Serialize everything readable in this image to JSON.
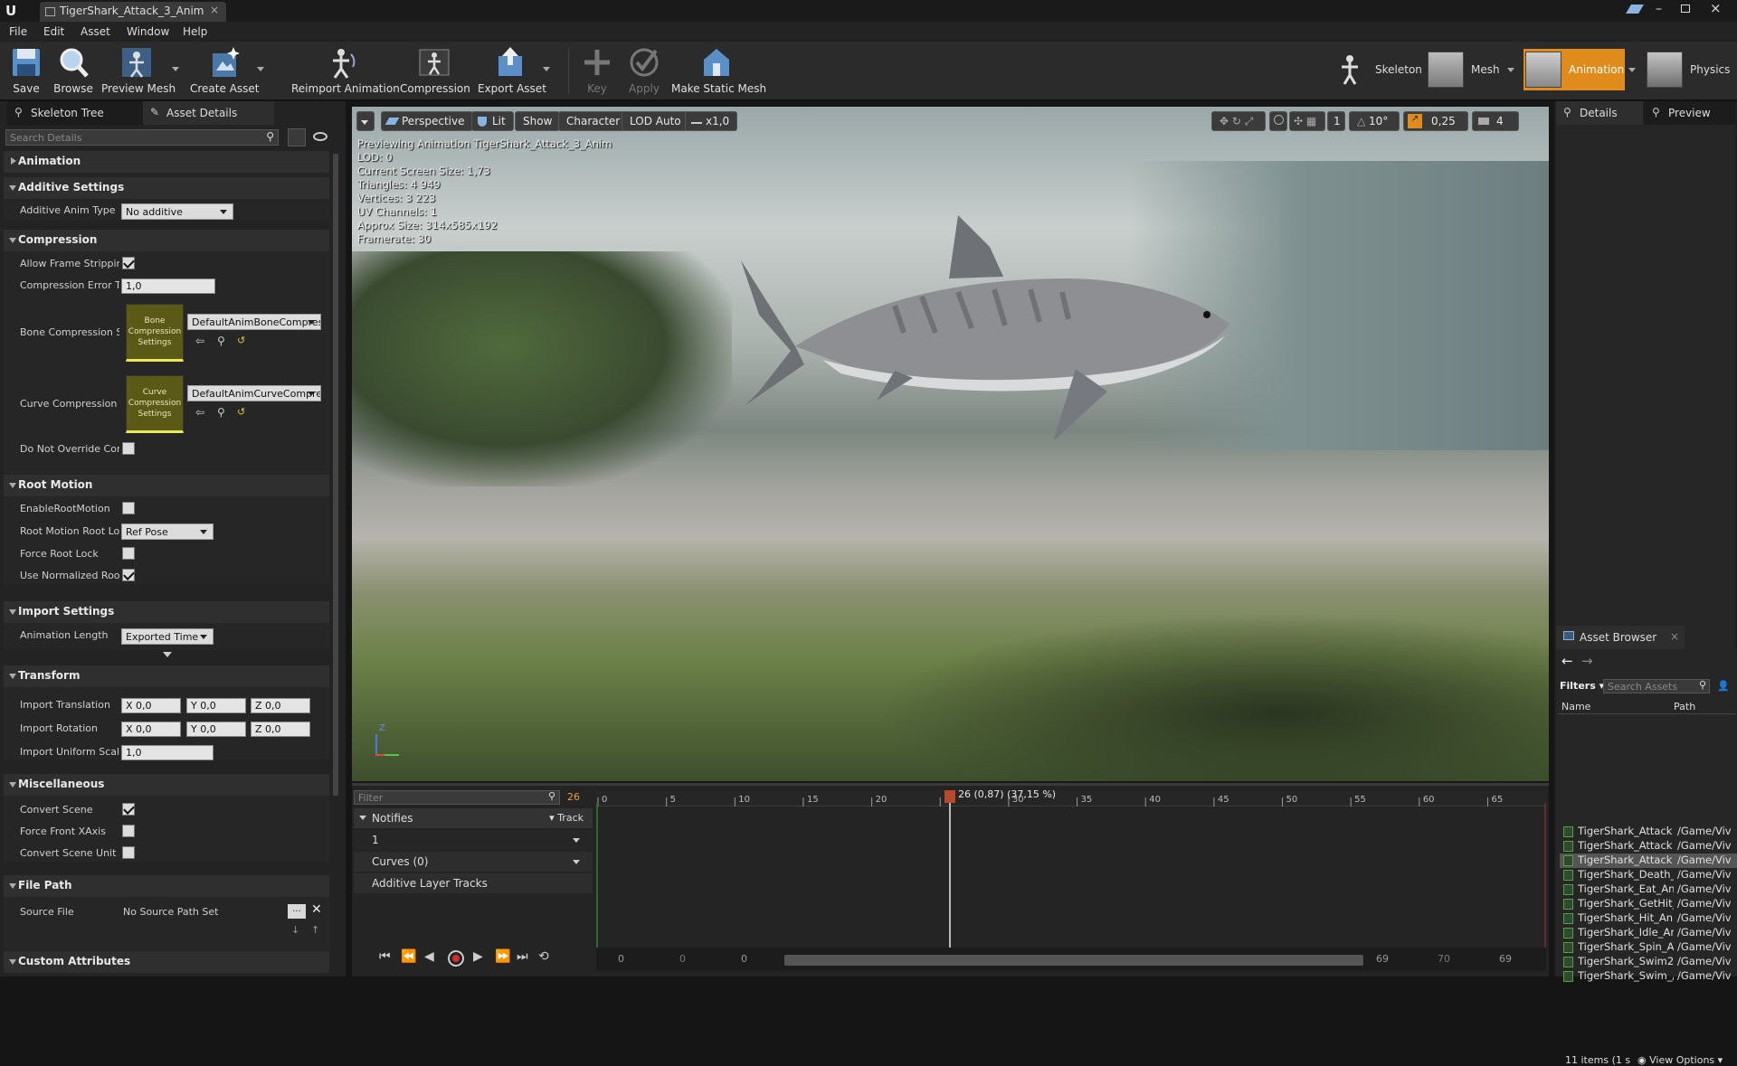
{
  "window": {
    "tab_title": "TigerShark_Attack_3_Anim"
  },
  "menu": [
    "File",
    "Edit",
    "Asset",
    "Window",
    "Help"
  ],
  "toolbar": {
    "save": "Save",
    "browse": "Browse",
    "preview_mesh": "Preview Mesh",
    "create_asset": "Create Asset",
    "reimport": "Reimport Animation",
    "compression": "Compression",
    "export_asset": "Export Asset",
    "key": "Key",
    "apply": "Apply",
    "make_static_mesh": "Make Static Mesh"
  },
  "modes": {
    "skeleton": "Skeleton",
    "mesh": "Mesh",
    "animation": "Animation",
    "physics": "Physics"
  },
  "left": {
    "tabs": {
      "skeleton_tree": "Skeleton Tree",
      "asset_details": "Asset Details"
    },
    "search_placeholder": "Search Details",
    "categories": {
      "animation": "Animation",
      "additive_settings": "Additive Settings",
      "compression": "Compression",
      "root_motion": "Root Motion",
      "import_settings": "Import Settings",
      "transform": "Transform",
      "misc": "Miscellaneous",
      "file_path": "File Path",
      "custom_attributes": "Custom Attributes"
    },
    "props": {
      "additive_anim_type": "Additive Anim Type",
      "additive_anim_type_value": "No additive",
      "allow_frame_stripping": "Allow Frame Stripping",
      "compression_error": "Compression Error Th",
      "compression_error_value": "1,0",
      "bone_compression": "Bone Compression Se",
      "bone_compression_value": "DefaultAnimBoneCompres",
      "bone_thumb": "Bone Compression Settings",
      "curve_compression": "Curve Compression S",
      "curve_compression_value": "DefaultAnimCurveCompre",
      "curve_thumb": "Curve Compression Settings",
      "do_not_override": "Do Not Override Com",
      "enable_root_motion": "EnableRootMotion",
      "root_motion_root_lock": "Root Motion Root Loc",
      "root_motion_root_lock_value": "Ref Pose",
      "force_root_lock": "Force Root Lock",
      "use_normalized_root": "Use Normalized Root",
      "animation_length": "Animation Length",
      "animation_length_value": "Exported Time",
      "import_translation": "Import Translation",
      "import_rotation": "Import Rotation",
      "import_uniform_scale": "Import Uniform Scale",
      "import_uniform_scale_value": "1,0",
      "x_label": "X",
      "y_label": "Y",
      "z_label": "Z",
      "zero": "0,0",
      "convert_scene": "Convert Scene",
      "force_front_xaxis": "Force Front XAxis",
      "convert_scene_unit": "Convert Scene Unit",
      "source_file": "Source File",
      "source_file_value": "No Source Path Set"
    }
  },
  "viewport": {
    "buttons": {
      "perspective": "Perspective",
      "lit": "Lit",
      "show": "Show",
      "character": "Character",
      "lod": "LOD Auto",
      "speed": "x1,0"
    },
    "right_tools": {
      "one": "1",
      "angle": "10°",
      "scale": "0,25",
      "cam_speed": "4"
    },
    "stats": [
      "Previewing Animation TigerShark_Attack_3_Anim",
      "LOD: 0",
      "Current Screen Size: 1,73",
      "Triangles: 4 949",
      "Vertices: 3 223",
      "UV Channels: 1",
      "Approx Size: 314x585x192",
      "Framerate: 30"
    ],
    "axis_z": "Z"
  },
  "timeline": {
    "filter_placeholder": "Filter",
    "frame": "26",
    "playhead_label": "26 (0,87) (37,15 %)",
    "ticks": [
      "0",
      "5",
      "10",
      "15",
      "20",
      "25",
      "30",
      "35",
      "40",
      "45",
      "50",
      "55",
      "60",
      "65"
    ],
    "notifies": "Notifies",
    "track": "Track",
    "notify_track_1": "1",
    "curves": "Curves",
    "curves_count": "(0)",
    "additive_layer": "Additive Layer Tracks",
    "bottom_left": [
      "0",
      "0",
      "0"
    ],
    "bottom_right": [
      "69",
      "70",
      "69"
    ]
  },
  "right": {
    "tabs": {
      "details": "Details",
      "preview": "Preview"
    },
    "asset_browser": "Asset Browser",
    "filters": "Filters",
    "search_placeholder": "Search Assets",
    "col_name": "Name",
    "col_path": "Path",
    "rows": [
      {
        "name": "TigerShark_Attack",
        "path": "/Game/Viv"
      },
      {
        "name": "TigerShark_Attack",
        "path": "/Game/Viv"
      },
      {
        "name": "TigerShark_Attack",
        "path": "/Game/Viv",
        "selected": true
      },
      {
        "name": "TigerShark_Death_",
        "path": "/Game/Viv"
      },
      {
        "name": "TigerShark_Eat_An",
        "path": "/Game/Viv"
      },
      {
        "name": "TigerShark_GetHit_",
        "path": "/Game/Viv"
      },
      {
        "name": "TigerShark_Hit_Ani",
        "path": "/Game/Viv"
      },
      {
        "name": "TigerShark_Idle_Ar",
        "path": "/Game/Viv"
      },
      {
        "name": "TigerShark_Spin_A",
        "path": "/Game/Viv"
      },
      {
        "name": "TigerShark_Swim2_",
        "path": "/Game/Viv"
      },
      {
        "name": "TigerShark_Swim_/",
        "path": "/Game/Viv"
      }
    ],
    "items_count": "11 items (1 s",
    "view_options": "View Options"
  },
  "colors": {
    "accent": "#e8a13a",
    "mode_active": "#e08c1c"
  }
}
